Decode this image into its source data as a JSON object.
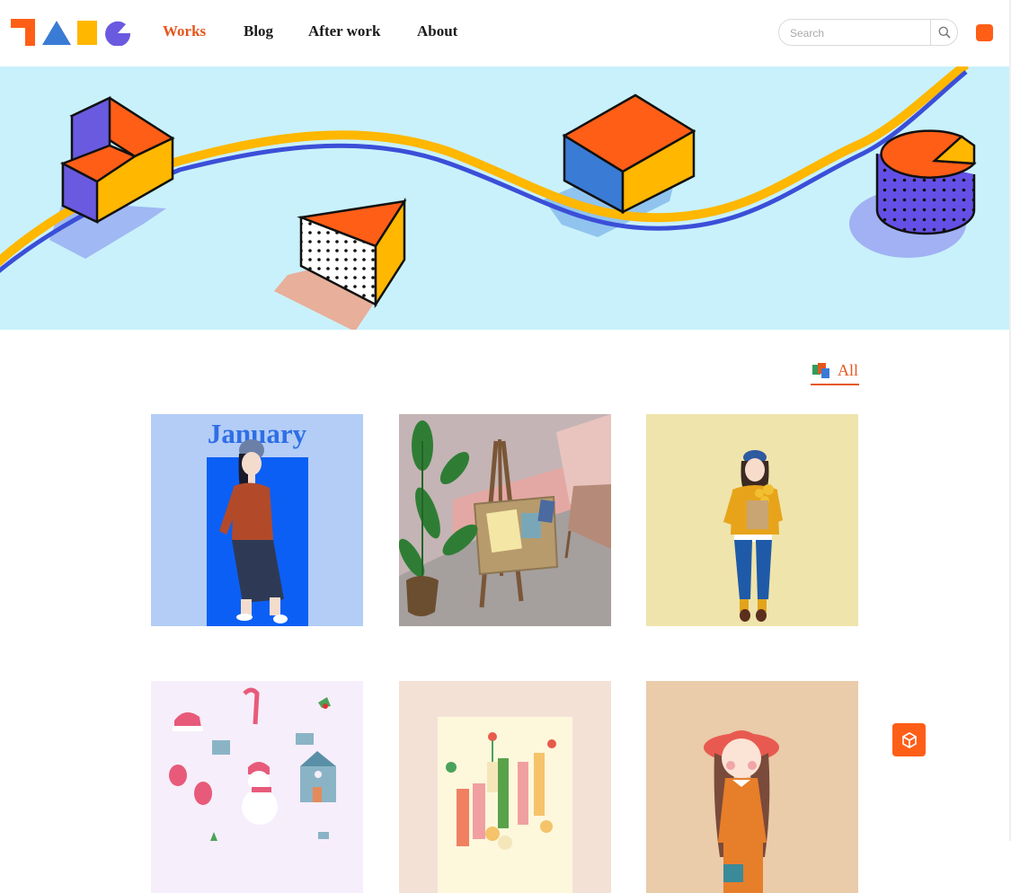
{
  "header": {
    "nav": [
      {
        "label": "Works",
        "active": true
      },
      {
        "label": "Blog",
        "active": false
      },
      {
        "label": "After work",
        "active": false
      },
      {
        "label": "About",
        "active": false
      }
    ],
    "search": {
      "placeholder": "Search",
      "value": ""
    }
  },
  "filter": {
    "label": "All"
  },
  "cards": [
    {
      "title": "January",
      "bg": "#b3cdf6"
    },
    {
      "bg": "#a59f9e"
    },
    {
      "bg": "#efe4ab"
    },
    {
      "bg": "#f6eefa"
    },
    {
      "bg": "#f3e1d6"
    },
    {
      "bg": "#eacbaa"
    }
  ],
  "colors": {
    "accent": "#e6561c",
    "brand_orange": "#ff5e17",
    "banner_bg": "#c9f1fb"
  },
  "icons": {
    "search": "search-icon",
    "float": "cube-icon"
  }
}
